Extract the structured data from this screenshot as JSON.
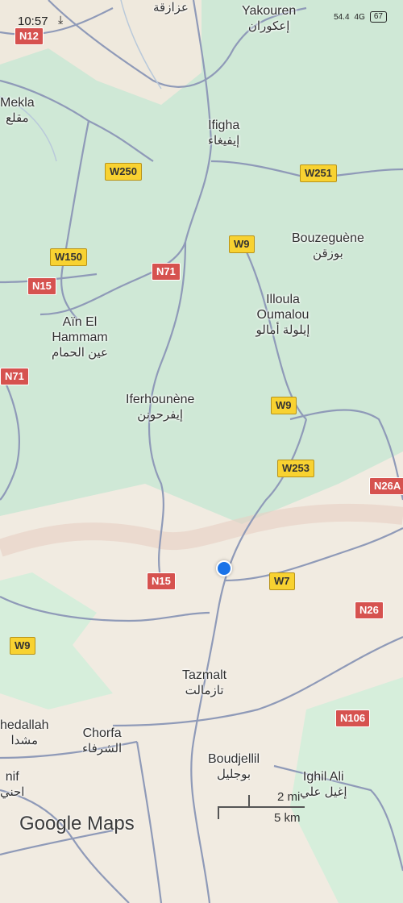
{
  "status_bar": {
    "time": "10:57",
    "download_icon": "⤓",
    "signal_text": "54.4",
    "network": "4G",
    "battery": "67"
  },
  "places": [
    {
      "id": "azazga",
      "name": "",
      "arabic": "عزازقة"
    },
    {
      "id": "yakouren",
      "name": "Yakouren",
      "arabic": "إعكوران"
    },
    {
      "id": "mekla",
      "name": "Mekla",
      "arabic": "مقلع"
    },
    {
      "id": "ifigha",
      "name": "Ifigha",
      "arabic": "إيفيغاء"
    },
    {
      "id": "bouzeguene",
      "name": "Bouzeguène",
      "arabic": "بوزقن"
    },
    {
      "id": "illoula",
      "name": "Illoula Oumalou",
      "arabic": "إيلولة أمالو"
    },
    {
      "id": "ain_el_hammam",
      "name": "Aïn El Hammam",
      "arabic": "عين الحمام"
    },
    {
      "id": "iferhounene",
      "name": "Iferhounène",
      "arabic": "إيفرحونن"
    },
    {
      "id": "tazmalt",
      "name": "Tazmalt",
      "arabic": "تازمالت"
    },
    {
      "id": "chorfa",
      "name": "Chorfa",
      "arabic": "الشرفاء"
    },
    {
      "id": "boudjellil",
      "name": "Boudjellil",
      "arabic": "بوجليل"
    },
    {
      "id": "ighil_ali",
      "name": "Ighil Ali",
      "arabic": "إغيل علي"
    },
    {
      "id": "chedallah",
      "name": "hedallah",
      "arabic": "مشدا"
    },
    {
      "id": "nif",
      "name": "nif",
      "arabic": "احني"
    }
  ],
  "road_shields": [
    {
      "id": "n12",
      "label": "N12",
      "type": "national"
    },
    {
      "id": "w250",
      "label": "W250",
      "type": "wilaya"
    },
    {
      "id": "w251",
      "label": "W251",
      "type": "wilaya"
    },
    {
      "id": "w9a",
      "label": "W9",
      "type": "wilaya"
    },
    {
      "id": "w150",
      "label": "W150",
      "type": "wilaya"
    },
    {
      "id": "n71a",
      "label": "N71",
      "type": "national"
    },
    {
      "id": "n15a",
      "label": "N15",
      "type": "national"
    },
    {
      "id": "n71b",
      "label": "N71",
      "type": "national"
    },
    {
      "id": "w9b",
      "label": "W9",
      "type": "wilaya"
    },
    {
      "id": "w253",
      "label": "W253",
      "type": "wilaya"
    },
    {
      "id": "n26a",
      "label": "N26A",
      "type": "national"
    },
    {
      "id": "n15b",
      "label": "N15",
      "type": "national"
    },
    {
      "id": "w7",
      "label": "W7",
      "type": "wilaya"
    },
    {
      "id": "n26",
      "label": "N26",
      "type": "national"
    },
    {
      "id": "w9c",
      "label": "W9",
      "type": "wilaya"
    },
    {
      "id": "n106",
      "label": "N106",
      "type": "national"
    }
  ],
  "scale": {
    "miles": "2 mi",
    "km": "5 km"
  },
  "logo": {
    "text1": "Google",
    "text2": " Maps"
  },
  "colors": {
    "forest": "#cfe8d6",
    "terrain": "#f1ebe1",
    "road": "#8f9ab8",
    "national": "#d6524f",
    "wilaya": "#f8d231",
    "location": "#1a73e8"
  }
}
